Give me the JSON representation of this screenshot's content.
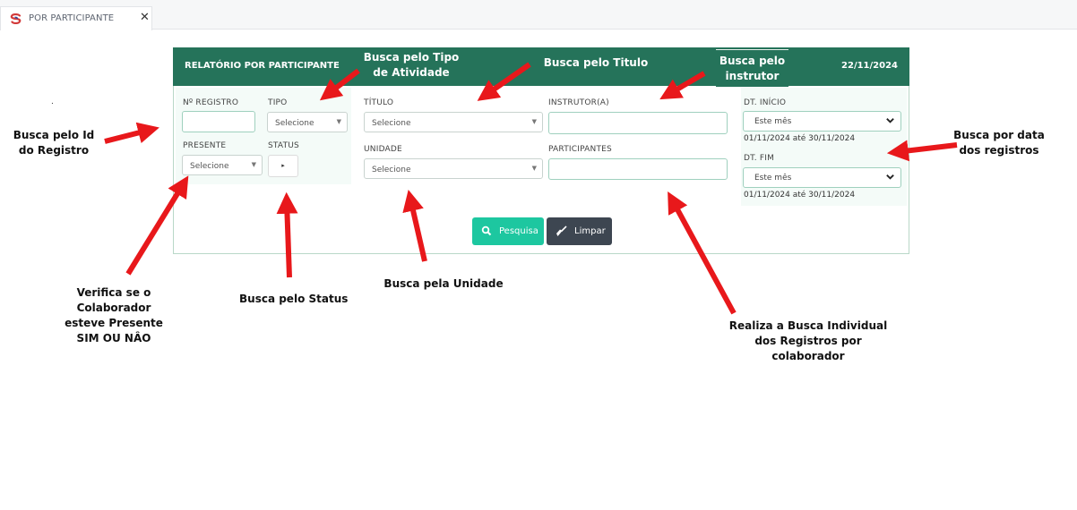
{
  "tab": {
    "label": "POR PARTICIPANTE",
    "close": "✕"
  },
  "panel": {
    "title": "RELATÓRIO POR PARTICIPANTE",
    "date": "22/11/2024"
  },
  "fields": {
    "registro": {
      "label": "Nº REGISTRO",
      "value": ""
    },
    "tipo": {
      "label": "TIPO",
      "value": "Selecione"
    },
    "presente": {
      "label": "PRESENTE",
      "value": "Selecione"
    },
    "status": {
      "label": "STATUS",
      "toggle": "▸"
    },
    "titulo": {
      "label": "TÍTULO",
      "value": "Selecione"
    },
    "unidade": {
      "label": "UNIDADE",
      "value": "Selecione"
    },
    "instrutor": {
      "label": "INSTRUTOR(A)",
      "value": ""
    },
    "participantes": {
      "label": "PARTICIPANTES",
      "value": ""
    },
    "dt_inicio": {
      "label": "DT. INÍCIO",
      "value": "Este mês",
      "range": "01/11/2024 até 30/11/2024"
    },
    "dt_fim": {
      "label": "DT. FIM",
      "value": "Este mês",
      "range": "01/11/2024 até 30/11/2024"
    }
  },
  "buttons": {
    "search": "Pesquisa",
    "clear": "Limpar"
  },
  "annotations": {
    "tipo_atividade": [
      "Busca pelo Tipo",
      "de Atividade"
    ],
    "titulo": "Busca pelo Titulo",
    "instrutor": [
      "Busca pelo",
      "instrutor"
    ],
    "id_registro": [
      "Busca pelo Id",
      "do Registro"
    ],
    "data": [
      "Busca por data",
      "dos registros"
    ],
    "presente": [
      "Verifica se o",
      "Colaborador",
      "esteve Presente",
      "SIM OU NÂO"
    ],
    "status": "Busca pelo Status",
    "unidade": "Busca pela Unidade",
    "individual": [
      "Realiza a Busca Individual",
      "dos Registros por",
      "colaborador"
    ]
  },
  "colors": {
    "header": "#25735a",
    "search_button": "#1dc7a0",
    "clear_button": "#3d4651",
    "arrow": "#e8181b",
    "field_border": "#9fd0be"
  },
  "icons": [
    "app-logo-icon",
    "close-icon",
    "chevron-down-icon",
    "caret-down-icon",
    "caret-right-icon",
    "search-icon",
    "broom-icon",
    "red-arrow-icon"
  ]
}
